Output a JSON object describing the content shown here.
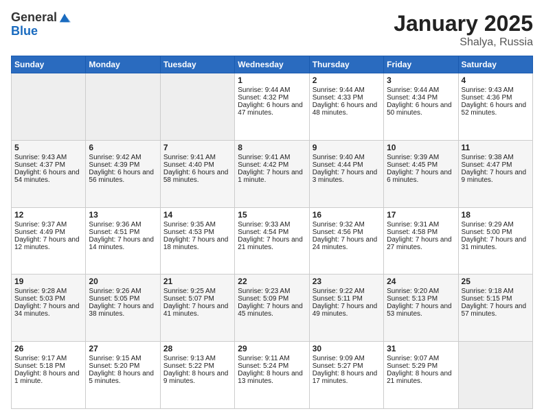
{
  "header": {
    "logo_general": "General",
    "logo_blue": "Blue",
    "month_title": "January 2025",
    "location": "Shalya, Russia"
  },
  "days_of_week": [
    "Sunday",
    "Monday",
    "Tuesday",
    "Wednesday",
    "Thursday",
    "Friday",
    "Saturday"
  ],
  "weeks": [
    [
      {
        "day": "",
        "sunrise": "",
        "sunset": "",
        "daylight": "",
        "empty": true
      },
      {
        "day": "",
        "sunrise": "",
        "sunset": "",
        "daylight": "",
        "empty": true
      },
      {
        "day": "",
        "sunrise": "",
        "sunset": "",
        "daylight": "",
        "empty": true
      },
      {
        "day": "1",
        "sunrise": "Sunrise: 9:44 AM",
        "sunset": "Sunset: 4:32 PM",
        "daylight": "Daylight: 6 hours and 47 minutes."
      },
      {
        "day": "2",
        "sunrise": "Sunrise: 9:44 AM",
        "sunset": "Sunset: 4:33 PM",
        "daylight": "Daylight: 6 hours and 48 minutes."
      },
      {
        "day": "3",
        "sunrise": "Sunrise: 9:44 AM",
        "sunset": "Sunset: 4:34 PM",
        "daylight": "Daylight: 6 hours and 50 minutes."
      },
      {
        "day": "4",
        "sunrise": "Sunrise: 9:43 AM",
        "sunset": "Sunset: 4:36 PM",
        "daylight": "Daylight: 6 hours and 52 minutes."
      }
    ],
    [
      {
        "day": "5",
        "sunrise": "Sunrise: 9:43 AM",
        "sunset": "Sunset: 4:37 PM",
        "daylight": "Daylight: 6 hours and 54 minutes."
      },
      {
        "day": "6",
        "sunrise": "Sunrise: 9:42 AM",
        "sunset": "Sunset: 4:39 PM",
        "daylight": "Daylight: 6 hours and 56 minutes."
      },
      {
        "day": "7",
        "sunrise": "Sunrise: 9:41 AM",
        "sunset": "Sunset: 4:40 PM",
        "daylight": "Daylight: 6 hours and 58 minutes."
      },
      {
        "day": "8",
        "sunrise": "Sunrise: 9:41 AM",
        "sunset": "Sunset: 4:42 PM",
        "daylight": "Daylight: 7 hours and 1 minute."
      },
      {
        "day": "9",
        "sunrise": "Sunrise: 9:40 AM",
        "sunset": "Sunset: 4:44 PM",
        "daylight": "Daylight: 7 hours and 3 minutes."
      },
      {
        "day": "10",
        "sunrise": "Sunrise: 9:39 AM",
        "sunset": "Sunset: 4:45 PM",
        "daylight": "Daylight: 7 hours and 6 minutes."
      },
      {
        "day": "11",
        "sunrise": "Sunrise: 9:38 AM",
        "sunset": "Sunset: 4:47 PM",
        "daylight": "Daylight: 7 hours and 9 minutes."
      }
    ],
    [
      {
        "day": "12",
        "sunrise": "Sunrise: 9:37 AM",
        "sunset": "Sunset: 4:49 PM",
        "daylight": "Daylight: 7 hours and 12 minutes."
      },
      {
        "day": "13",
        "sunrise": "Sunrise: 9:36 AM",
        "sunset": "Sunset: 4:51 PM",
        "daylight": "Daylight: 7 hours and 14 minutes."
      },
      {
        "day": "14",
        "sunrise": "Sunrise: 9:35 AM",
        "sunset": "Sunset: 4:53 PM",
        "daylight": "Daylight: 7 hours and 18 minutes."
      },
      {
        "day": "15",
        "sunrise": "Sunrise: 9:33 AM",
        "sunset": "Sunset: 4:54 PM",
        "daylight": "Daylight: 7 hours and 21 minutes."
      },
      {
        "day": "16",
        "sunrise": "Sunrise: 9:32 AM",
        "sunset": "Sunset: 4:56 PM",
        "daylight": "Daylight: 7 hours and 24 minutes."
      },
      {
        "day": "17",
        "sunrise": "Sunrise: 9:31 AM",
        "sunset": "Sunset: 4:58 PM",
        "daylight": "Daylight: 7 hours and 27 minutes."
      },
      {
        "day": "18",
        "sunrise": "Sunrise: 9:29 AM",
        "sunset": "Sunset: 5:00 PM",
        "daylight": "Daylight: 7 hours and 31 minutes."
      }
    ],
    [
      {
        "day": "19",
        "sunrise": "Sunrise: 9:28 AM",
        "sunset": "Sunset: 5:03 PM",
        "daylight": "Daylight: 7 hours and 34 minutes."
      },
      {
        "day": "20",
        "sunrise": "Sunrise: 9:26 AM",
        "sunset": "Sunset: 5:05 PM",
        "daylight": "Daylight: 7 hours and 38 minutes."
      },
      {
        "day": "21",
        "sunrise": "Sunrise: 9:25 AM",
        "sunset": "Sunset: 5:07 PM",
        "daylight": "Daylight: 7 hours and 41 minutes."
      },
      {
        "day": "22",
        "sunrise": "Sunrise: 9:23 AM",
        "sunset": "Sunset: 5:09 PM",
        "daylight": "Daylight: 7 hours and 45 minutes."
      },
      {
        "day": "23",
        "sunrise": "Sunrise: 9:22 AM",
        "sunset": "Sunset: 5:11 PM",
        "daylight": "Daylight: 7 hours and 49 minutes."
      },
      {
        "day": "24",
        "sunrise": "Sunrise: 9:20 AM",
        "sunset": "Sunset: 5:13 PM",
        "daylight": "Daylight: 7 hours and 53 minutes."
      },
      {
        "day": "25",
        "sunrise": "Sunrise: 9:18 AM",
        "sunset": "Sunset: 5:15 PM",
        "daylight": "Daylight: 7 hours and 57 minutes."
      }
    ],
    [
      {
        "day": "26",
        "sunrise": "Sunrise: 9:17 AM",
        "sunset": "Sunset: 5:18 PM",
        "daylight": "Daylight: 8 hours and 1 minute."
      },
      {
        "day": "27",
        "sunrise": "Sunrise: 9:15 AM",
        "sunset": "Sunset: 5:20 PM",
        "daylight": "Daylight: 8 hours and 5 minutes."
      },
      {
        "day": "28",
        "sunrise": "Sunrise: 9:13 AM",
        "sunset": "Sunset: 5:22 PM",
        "daylight": "Daylight: 8 hours and 9 minutes."
      },
      {
        "day": "29",
        "sunrise": "Sunrise: 9:11 AM",
        "sunset": "Sunset: 5:24 PM",
        "daylight": "Daylight: 8 hours and 13 minutes."
      },
      {
        "day": "30",
        "sunrise": "Sunrise: 9:09 AM",
        "sunset": "Sunset: 5:27 PM",
        "daylight": "Daylight: 8 hours and 17 minutes."
      },
      {
        "day": "31",
        "sunrise": "Sunrise: 9:07 AM",
        "sunset": "Sunset: 5:29 PM",
        "daylight": "Daylight: 8 hours and 21 minutes."
      },
      {
        "day": "",
        "sunrise": "",
        "sunset": "",
        "daylight": "",
        "empty": true
      }
    ]
  ]
}
